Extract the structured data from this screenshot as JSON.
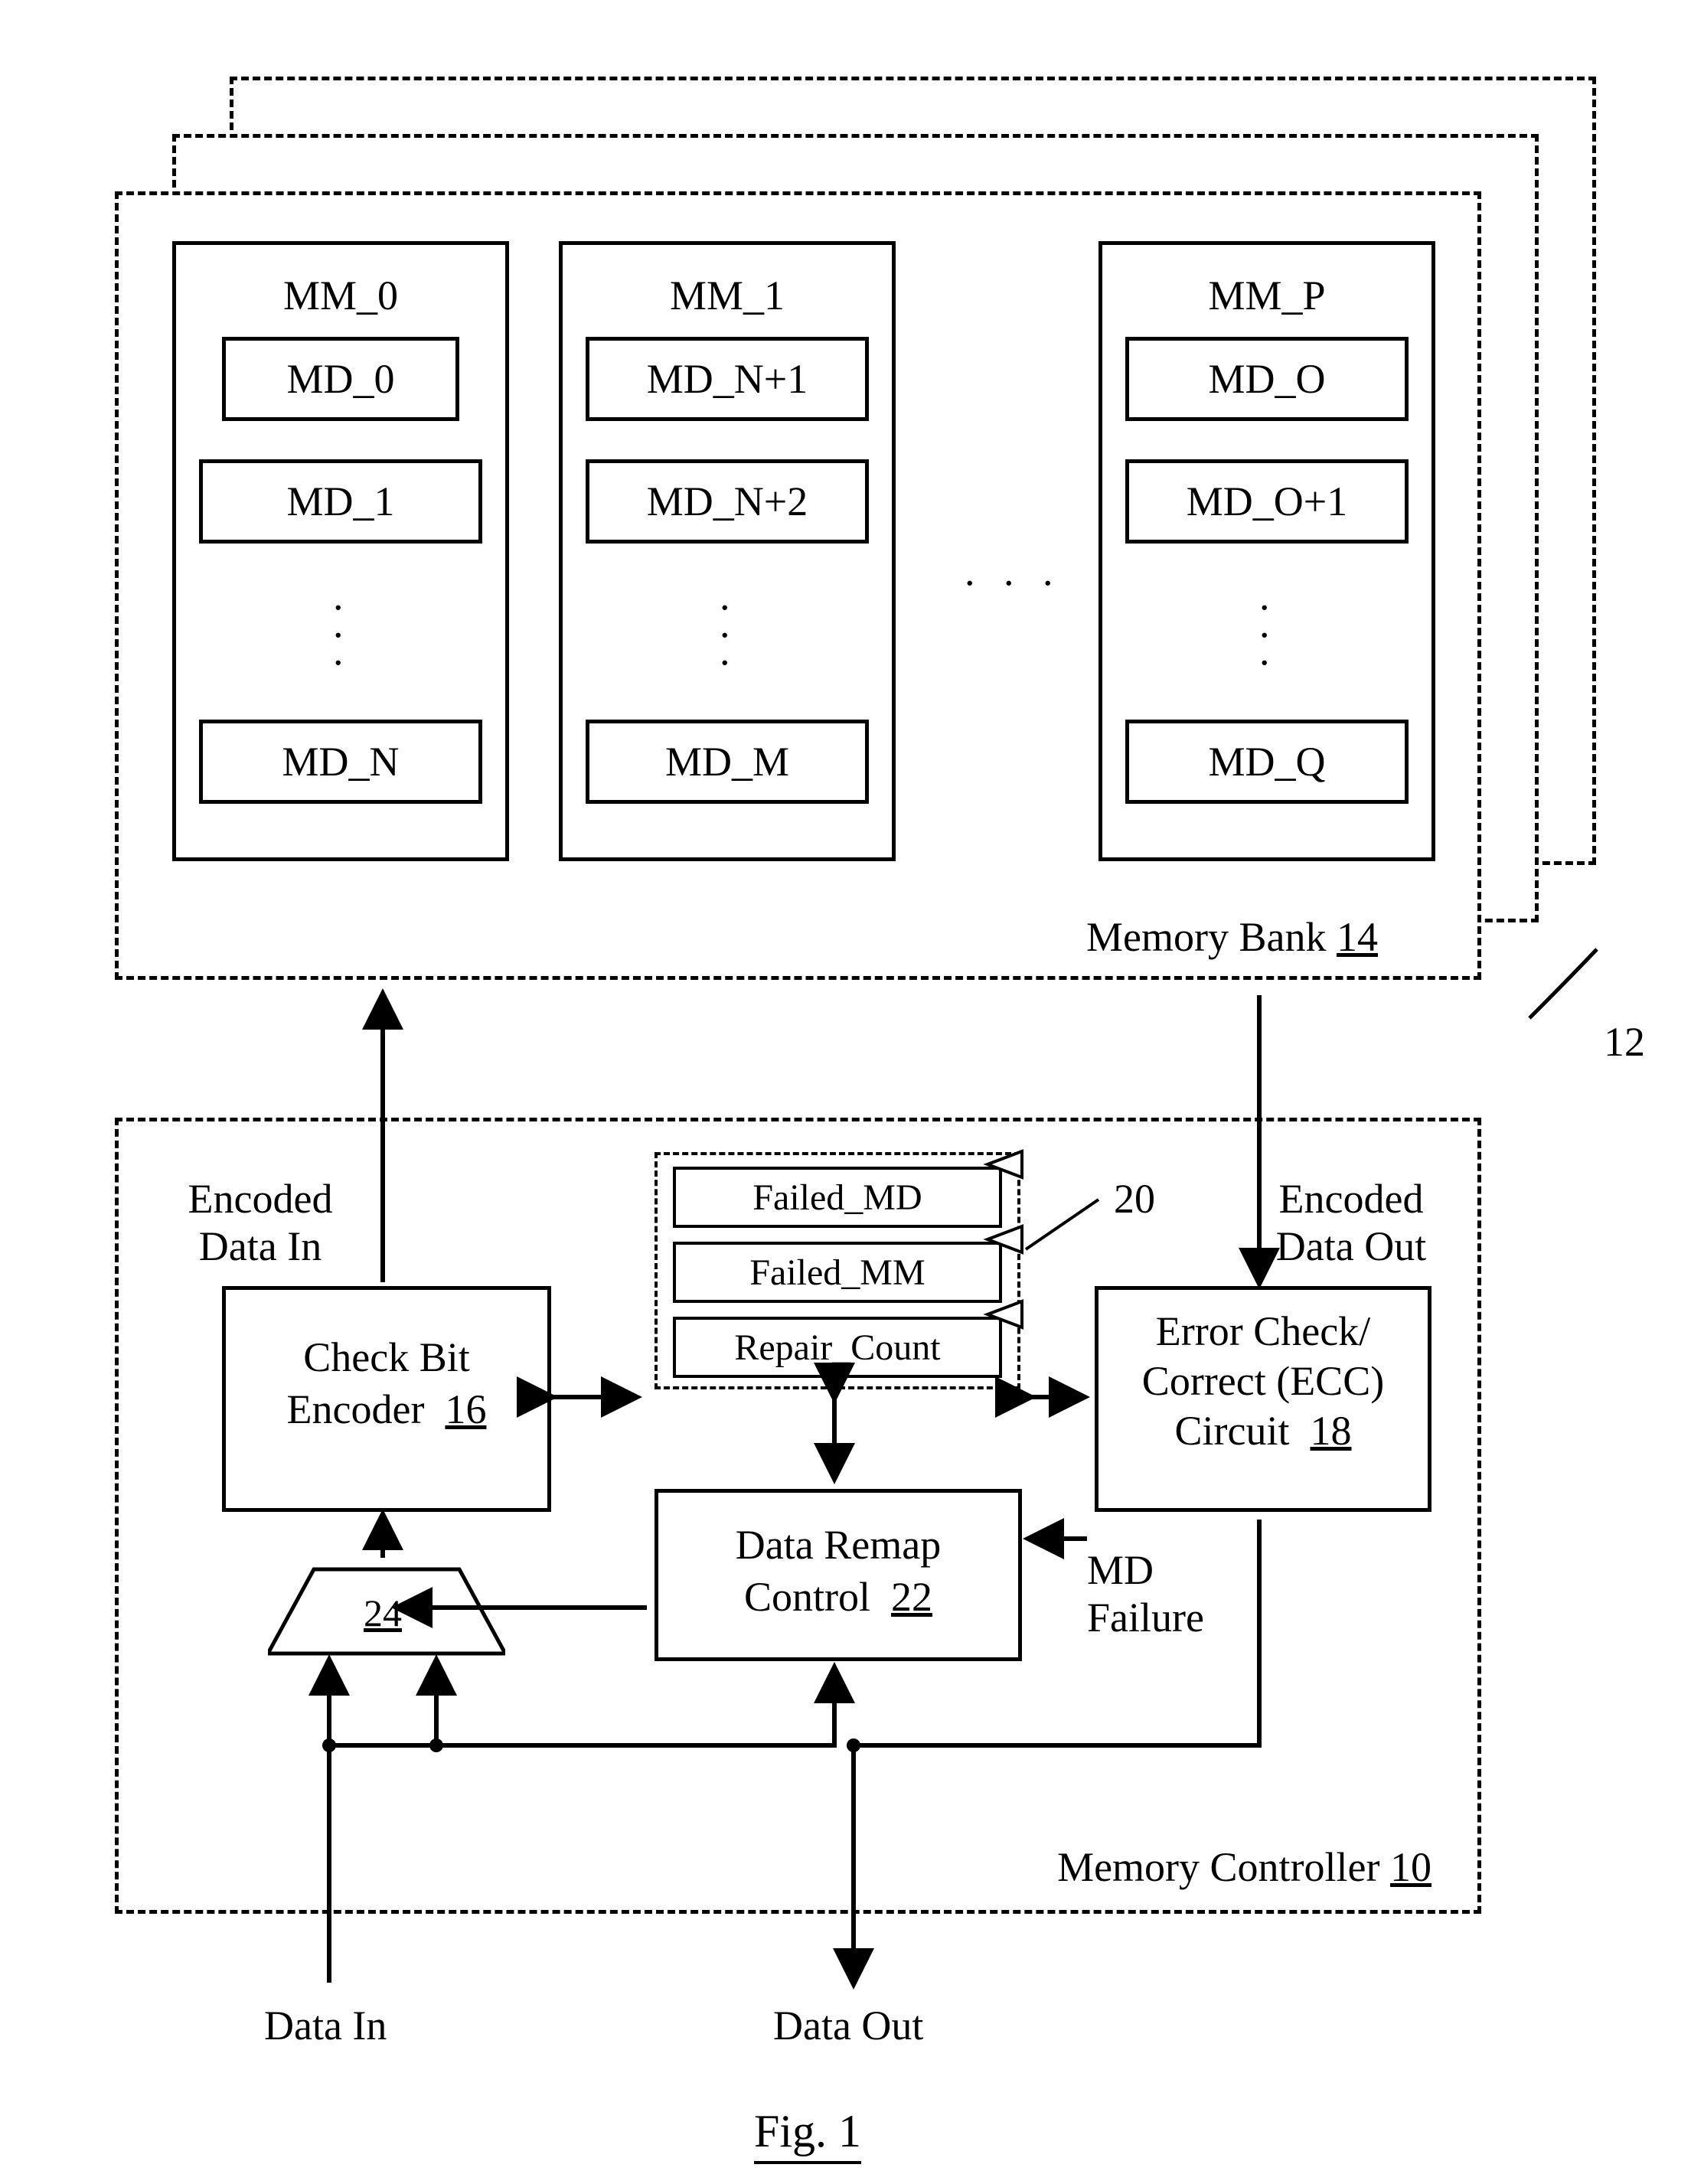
{
  "fig_label": "Fig. 1",
  "memory_system": {
    "ref": "12",
    "bank_label": "Memory Bank",
    "bank_ref": "14",
    "modules": [
      {
        "title": "MM_0",
        "devices": [
          "MD_0",
          "MD_1",
          "MD_N"
        ]
      },
      {
        "title": "MM_1",
        "devices": [
          "MD_N+1",
          "MD_N+2",
          "MD_M"
        ]
      },
      {
        "title": "MM_P",
        "devices": [
          "MD_O",
          "MD_O+1",
          "MD_Q"
        ]
      }
    ],
    "module_ellipsis": ". . ."
  },
  "controller": {
    "label": "Memory Controller",
    "ref": "10",
    "encoded_in_l1": "Encoded",
    "encoded_in_l2": "Data In",
    "encoded_out_l1": "Encoded",
    "encoded_out_l2": "Data Out",
    "encoder_l1": "Check Bit",
    "encoder_l2": "Encoder",
    "encoder_ref": "16",
    "registers_ref": "20",
    "registers": [
      "Failed_MD",
      "Failed_MM",
      "Repair_Count"
    ],
    "ecc_l1": "Error Check/",
    "ecc_l2": "Correct (ECC)",
    "ecc_l3": "Circuit",
    "ecc_ref": "18",
    "remap_l1": "Data Remap",
    "remap_l2": "Control",
    "remap_ref": "22",
    "mux_ref": "24",
    "md_failure_l1": "MD",
    "md_failure_l2": "Failure",
    "data_in": "Data In",
    "data_out": "Data Out"
  }
}
